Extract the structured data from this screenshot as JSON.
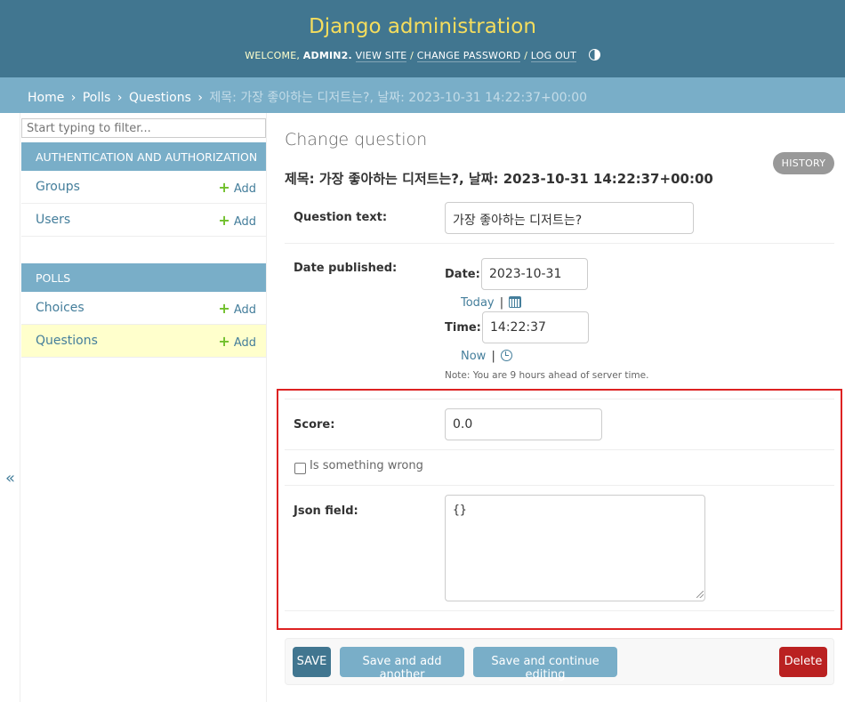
{
  "header": {
    "site_name": "Django administration",
    "welcome": "WELCOME,",
    "username": "ADMIN2.",
    "view_site": "VIEW SITE",
    "change_password": "CHANGE PASSWORD",
    "log_out": "LOG OUT",
    "sep": "/"
  },
  "breadcrumbs": {
    "home": "Home",
    "app": "Polls",
    "model": "Questions",
    "current": "제목: 가장 좋아하는 디저트는?, 날짜: 2023-10-31 14:22:37+00:00",
    "sep": "›"
  },
  "sidebar": {
    "filter_placeholder": "Start typing to filter...",
    "toggle_glyph": "«",
    "add_label": "Add",
    "add_glyph": "+",
    "modules": [
      {
        "caption": "AUTHENTICATION AND AUTHORIZATION",
        "models": [
          {
            "name": "Groups"
          },
          {
            "name": "Users"
          }
        ]
      },
      {
        "caption": "POLLS",
        "models": [
          {
            "name": "Choices"
          },
          {
            "name": "Questions",
            "current": true
          }
        ]
      }
    ]
  },
  "content": {
    "title": "Change question",
    "object_title": "제목: 가장 좋아하는 디저트는?, 날짜: 2023-10-31 14:22:37+00:00",
    "history_label": "HISTORY",
    "fields": {
      "question_text": {
        "label": "Question text:",
        "value": "가장 좋아하는 디저트는?"
      },
      "date_published": {
        "label": "Date published:",
        "date_label": "Date:",
        "date_value": "2023-10-31",
        "today_label": "Today",
        "time_label": "Time:",
        "time_value": "14:22:37",
        "now_label": "Now",
        "bar": "|",
        "note": "Note: You are 9 hours ahead of server time."
      },
      "score": {
        "label": "Score:",
        "value": "0.0"
      },
      "is_something_wrong": {
        "label": "Is something wrong",
        "checked": false
      },
      "json_field": {
        "label": "Json field:",
        "value": "{}"
      }
    },
    "actions": {
      "save": "SAVE",
      "save_add_another": "Save and add another",
      "save_continue": "Save and continue editing",
      "delete": "Delete"
    }
  },
  "colors": {
    "header_bg": "#417690",
    "site_name": "#f5dd5d",
    "breadcrumb_bg": "#79aec8",
    "link": "#447e9b",
    "add_plus": "#70bf2b",
    "current_row": "#ffffcc",
    "delete": "#ba2121",
    "highlight_border": "#dd2222"
  }
}
